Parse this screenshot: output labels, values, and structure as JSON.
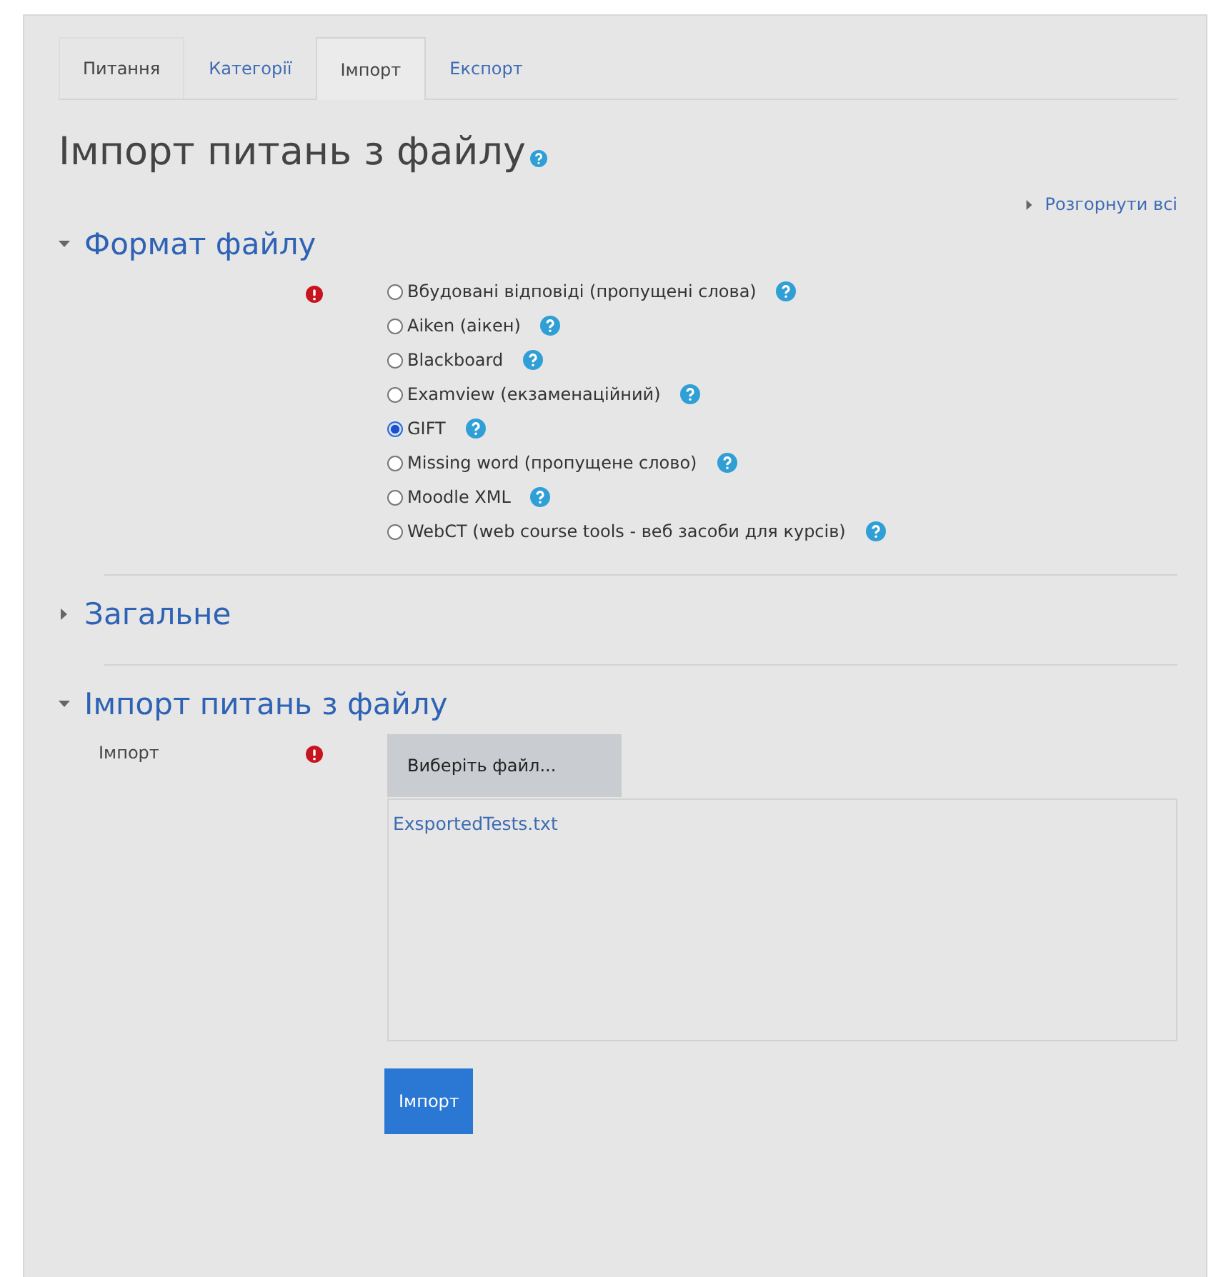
{
  "tabs": [
    {
      "label": "Питання",
      "selected": false
    },
    {
      "label": "Категорії",
      "selected": false
    },
    {
      "label": "Імпорт",
      "selected": true
    },
    {
      "label": "Експорт",
      "selected": false
    }
  ],
  "title": "Імпорт питань з файлу",
  "expand_all": "Розгорнути всі",
  "sections": [
    {
      "kind": "radio-group",
      "title": "Формат файлу",
      "expanded": true,
      "required": true,
      "options": [
        {
          "label": "Вбудовані відповіді (пропущені слова)",
          "selected": false
        },
        {
          "label": "Aiken (аікен)",
          "selected": false
        },
        {
          "label": "Blackboard",
          "selected": false
        },
        {
          "label": "Examview (екзаменаційний)",
          "selected": false
        },
        {
          "label": "GIFT",
          "selected": true
        },
        {
          "label": "Missing word (пропущене слово)",
          "selected": false
        },
        {
          "label": "Moodle XML",
          "selected": false
        },
        {
          "label": "WebCT (web course tools - веб засоби для курсів)",
          "selected": false
        }
      ]
    },
    {
      "kind": "collapsed",
      "title": "Загальне",
      "expanded": false
    },
    {
      "kind": "file-picker",
      "title": "Імпорт питань з файлу",
      "expanded": true,
      "label": "Імпорт",
      "required": true,
      "choose_button": "Виберіть файл...",
      "file": "ExsportedTests.txt"
    }
  ],
  "submit": "Імпорт"
}
